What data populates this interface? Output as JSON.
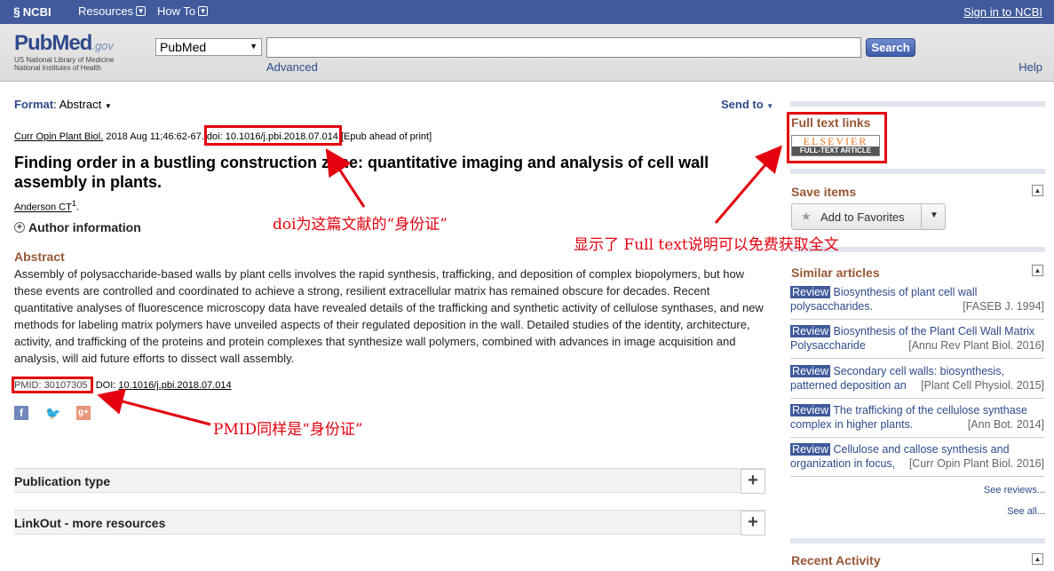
{
  "topbar": {
    "ncbi": "NCBI",
    "resources": "Resources",
    "howto": "How To",
    "signin": "Sign in to NCBI"
  },
  "search": {
    "logo_pub": "Pub",
    "logo_med": "Med",
    "logo_gov": ".gov",
    "logo_sub1": "US National Library of Medicine",
    "logo_sub2": "National Institutes of Health",
    "db": "PubMed",
    "query": "",
    "button": "Search",
    "advanced": "Advanced",
    "help": "Help"
  },
  "format": {
    "label": "Format",
    "value": "Abstract"
  },
  "sendto": "Send to",
  "citation": {
    "journal": "Curr Opin Plant Biol.",
    "date": "2018 Aug 11;46:62-67.",
    "doi": "doi: 10.1016/j.pbi.2018.07.014",
    "epub": "[Epub ahead of print]"
  },
  "article": {
    "title": "Finding order in a bustling construction zone: quantitative imaging and analysis of cell wall assembly in plants.",
    "author": "Anderson CT",
    "author_sup": "1",
    "author_info": "Author information",
    "abstract_head": "Abstract",
    "abstract": "Assembly of polysaccharide-based walls by plant cells involves the rapid synthesis, trafficking, and deposition of complex biopolymers, but how these events are controlled and coordinated to achieve a strong, resilient extracellular matrix has remained obscure for decades. Recent quantitative analyses of fluorescence microscopy data have revealed details of the trafficking and synthetic activity of cellulose synthases, and new methods for labeling matrix polymers have unveiled aspects of their regulated deposition in the wall. Detailed studies of the identity, architecture, activity, and trafficking of the proteins and protein complexes that synthesize wall polymers, combined with advances in image acquisition and analysis, will aid future efforts to dissect wall assembly.",
    "pmid": "PMID: 30107305",
    "doi_label": "DOI:",
    "doi": "10.1016/j.pbi.2018.07.014"
  },
  "sections": [
    "Publication type",
    "LinkOut - more resources"
  ],
  "sidebar": {
    "fulltext_head": "Full text links",
    "elsevier": "ELSEVIER",
    "elsevier_sub": "FULL-TEXT ARTICLE",
    "save_head": "Save items",
    "add_fav": "Add to Favorites",
    "similar_head": "Similar articles",
    "similar": [
      {
        "tag": "Review",
        "title": "Biosynthesis of plant cell wall polysaccharides.",
        "journal": "[FASEB J. 1994]"
      },
      {
        "tag": "Review",
        "title": "Biosynthesis of the Plant Cell Wall Matrix Polysaccharide",
        "journal": "[Annu Rev Plant Biol. 2016]"
      },
      {
        "tag": "Review",
        "title": "Secondary cell walls: biosynthesis, patterned deposition an",
        "journal": "[Plant Cell Physiol. 2015]"
      },
      {
        "tag": "Review",
        "title": "The trafficking of the cellulose synthase complex in higher plants.",
        "journal": "[Ann Bot. 2014]"
      },
      {
        "tag": "Review",
        "title": "Cellulose and callose synthesis and organization in focus,",
        "journal": "[Curr Opin Plant Biol. 2016]"
      }
    ],
    "see_reviews": "See reviews...",
    "see_all": "See all...",
    "recent_head": "Recent Activity"
  },
  "annotations": {
    "doi_note": "doi为这篇文献的“身份证”",
    "fulltext_note": "显示了 Full text说明可以免费获取全文",
    "pmid_note": "PMID同样是“身份证”"
  },
  "colors": {
    "annotation": "#e4000e",
    "ncbi_bar": "#405a9b",
    "heading": "#985735"
  }
}
